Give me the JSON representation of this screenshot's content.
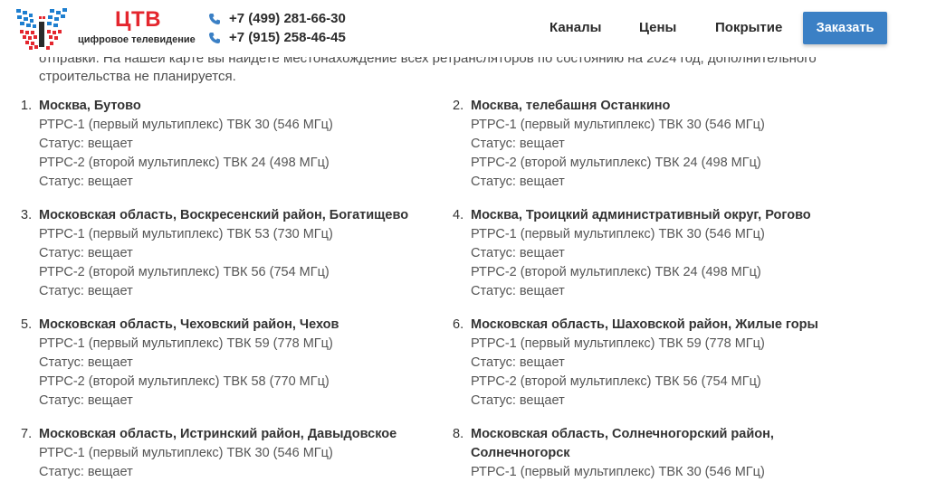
{
  "header": {
    "brand": "ЦТВ",
    "tagline": "цифровое телевидение",
    "phones": [
      "+7 (499) 281-66-30",
      "+7 (915) 258-46-45"
    ],
    "nav": [
      "Каналы",
      "Цены",
      "Покрытие"
    ],
    "order_label": "Заказать",
    "accent_color": "#3b80c5",
    "brand_color": "#e4262e"
  },
  "intro": {
    "cut_line": "отправки. На нашей карте вы найдете местонахождение всех ретрансляторов по состоянию на 2024 год, дополнительного",
    "line2": "строительства не планируется."
  },
  "entries": [
    {
      "num": "1.",
      "title": "Москва, Бутово",
      "lines": [
        "РТРС-1 (первый мультиплекс) ТВК 30 (546 МГц)",
        "Статус: вещает",
        "РТРС-2 (второй мультиплекс) ТВК 24 (498 МГц)",
        "Статус: вещает"
      ]
    },
    {
      "num": "2.",
      "title": "Москва, телебашня Останкино",
      "lines": [
        "РТРС-1 (первый мультиплекс) ТВК 30 (546 МГц)",
        "Статус: вещает",
        "РТРС-2 (второй мультиплекс) ТВК 24 (498 МГц)",
        "Статус: вещает"
      ]
    },
    {
      "num": "3.",
      "title": "Московская область, Воскресенский район, Богатищево",
      "lines": [
        "РТРС-1 (первый мультиплекс) ТВК 53 (730 МГц)",
        "Статус: вещает",
        "РТРС-2 (второй мультиплекс) ТВК 56 (754 МГц)",
        "Статус: вещает"
      ]
    },
    {
      "num": "4.",
      "title": "Москва, Троицкий административный округ, Рогово",
      "lines": [
        "РТРС-1 (первый мультиплекс) ТВК 30 (546 МГц)",
        "Статус: вещает",
        "РТРС-2 (второй мультиплекс) ТВК 24 (498 МГц)",
        "Статус: вещает"
      ]
    },
    {
      "num": "5.",
      "title": "Московская область, Чеховский район, Чехов",
      "lines": [
        "РТРС-1 (первый мультиплекс) ТВК 59 (778 МГц)",
        "Статус: вещает",
        "РТРС-2 (второй мультиплекс) ТВК 58 (770 МГц)",
        "Статус: вещает"
      ]
    },
    {
      "num": "6.",
      "title": "Московская область, Шаховской район, Жилые горы",
      "lines": [
        "РТРС-1 (первый мультиплекс) ТВК 59 (778 МГц)",
        "Статус: вещает",
        "РТРС-2 (второй мультиплекс) ТВК 56 (754 МГц)",
        "Статус: вещает"
      ]
    },
    {
      "num": "7.",
      "title": "Московская область, Истринский район, Давыдовское",
      "lines": [
        "РТРС-1 (первый мультиплекс) ТВК 30 (546 МГц)",
        "Статус: вещает"
      ]
    },
    {
      "num": "8.",
      "title": "Московская область, Солнечногорский район, Солнечногорск",
      "lines": [
        "РТРС-1 (первый мультиплекс) ТВК 30 (546 МГц)"
      ]
    }
  ]
}
